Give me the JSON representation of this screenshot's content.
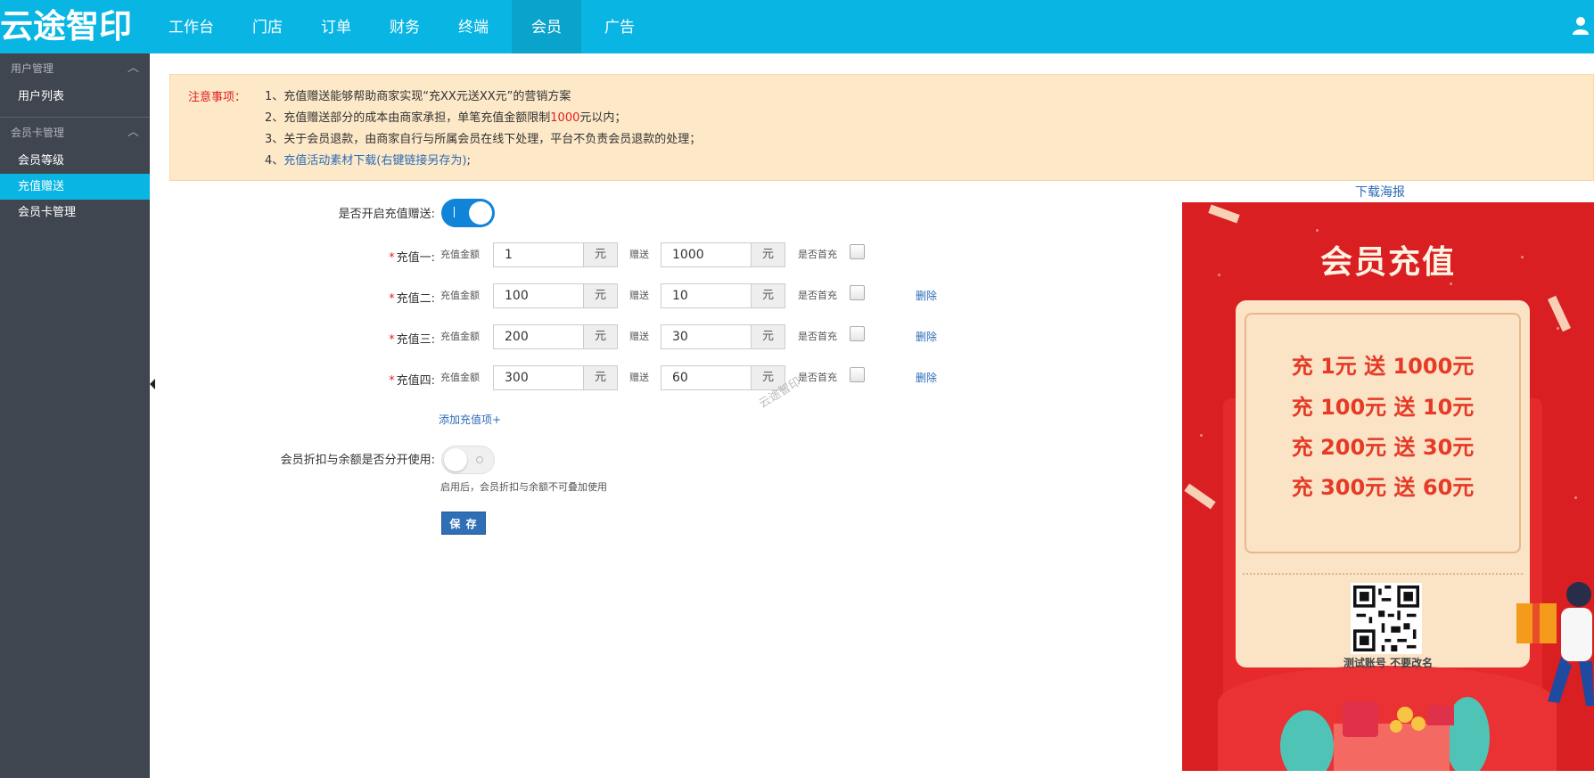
{
  "app": {
    "logo": "云途智印"
  },
  "nav": {
    "items": [
      {
        "label": "工作台"
      },
      {
        "label": "门店"
      },
      {
        "label": "订单"
      },
      {
        "label": "财务"
      },
      {
        "label": "终端"
      },
      {
        "label": "会员",
        "active": true
      },
      {
        "label": "广告"
      }
    ]
  },
  "sidebar": {
    "groups": [
      {
        "title": "用户管理",
        "items": [
          {
            "label": "用户列表"
          }
        ]
      },
      {
        "title": "会员卡管理",
        "items": [
          {
            "label": "会员等级"
          },
          {
            "label": "充值赠送",
            "active": true
          },
          {
            "label": "会员卡管理"
          }
        ]
      }
    ]
  },
  "notice": {
    "label": "注意事项：",
    "line1": "1、充值赠送能够帮助商家实现“充XX元送XX元”的营销方案",
    "line2_pre": "2、充值赠送部分的成本由商家承担，单笔充值金额限制",
    "line2_red": "1000",
    "line2_post": "元以内；",
    "line3": "3、关于会员退款，由商家自行与所属会员在线下处理，平台不负责会员退款的处理；",
    "line4_pre": "4、",
    "line4_link": "充值活动素材下载(右键链接另存为)",
    "line4_post": ";"
  },
  "form": {
    "enable_label": "是否开启充值赠送:",
    "enable_on": true,
    "amount_label": "充值金额",
    "gift_label": "赠送",
    "unit": "元",
    "first_label": "是否首充",
    "delete_label": "删除",
    "required_mark": "*",
    "rows": [
      {
        "label": "充值一:",
        "amount": "1",
        "gift": "1000",
        "first": false
      },
      {
        "label": "充值二:",
        "amount": "100",
        "gift": "10",
        "first": false
      },
      {
        "label": "充值三:",
        "amount": "200",
        "gift": "30",
        "first": false
      },
      {
        "label": "充值四:",
        "amount": "300",
        "gift": "60",
        "first": false
      }
    ],
    "add_item": "添加充值项+",
    "split_label": "会员折扣与余额是否分开使用:",
    "split_on": false,
    "split_hint": "启用后，会员折扣与余额不可叠加使用",
    "save": "保 存",
    "watermark": "云途智印"
  },
  "poster": {
    "download": "下载海报",
    "title": "会员充值",
    "offers": [
      "充 1元 送 1000元",
      "充 100元 送 10元",
      "充 200元 送 30元",
      "充 300元 送 60元"
    ],
    "caption": "测试账号 不要改名"
  },
  "colors": {
    "topbar": "#09b6e3",
    "sidebar": "#404650",
    "accent": "#09b6e3",
    "poster": "#d91f22"
  }
}
